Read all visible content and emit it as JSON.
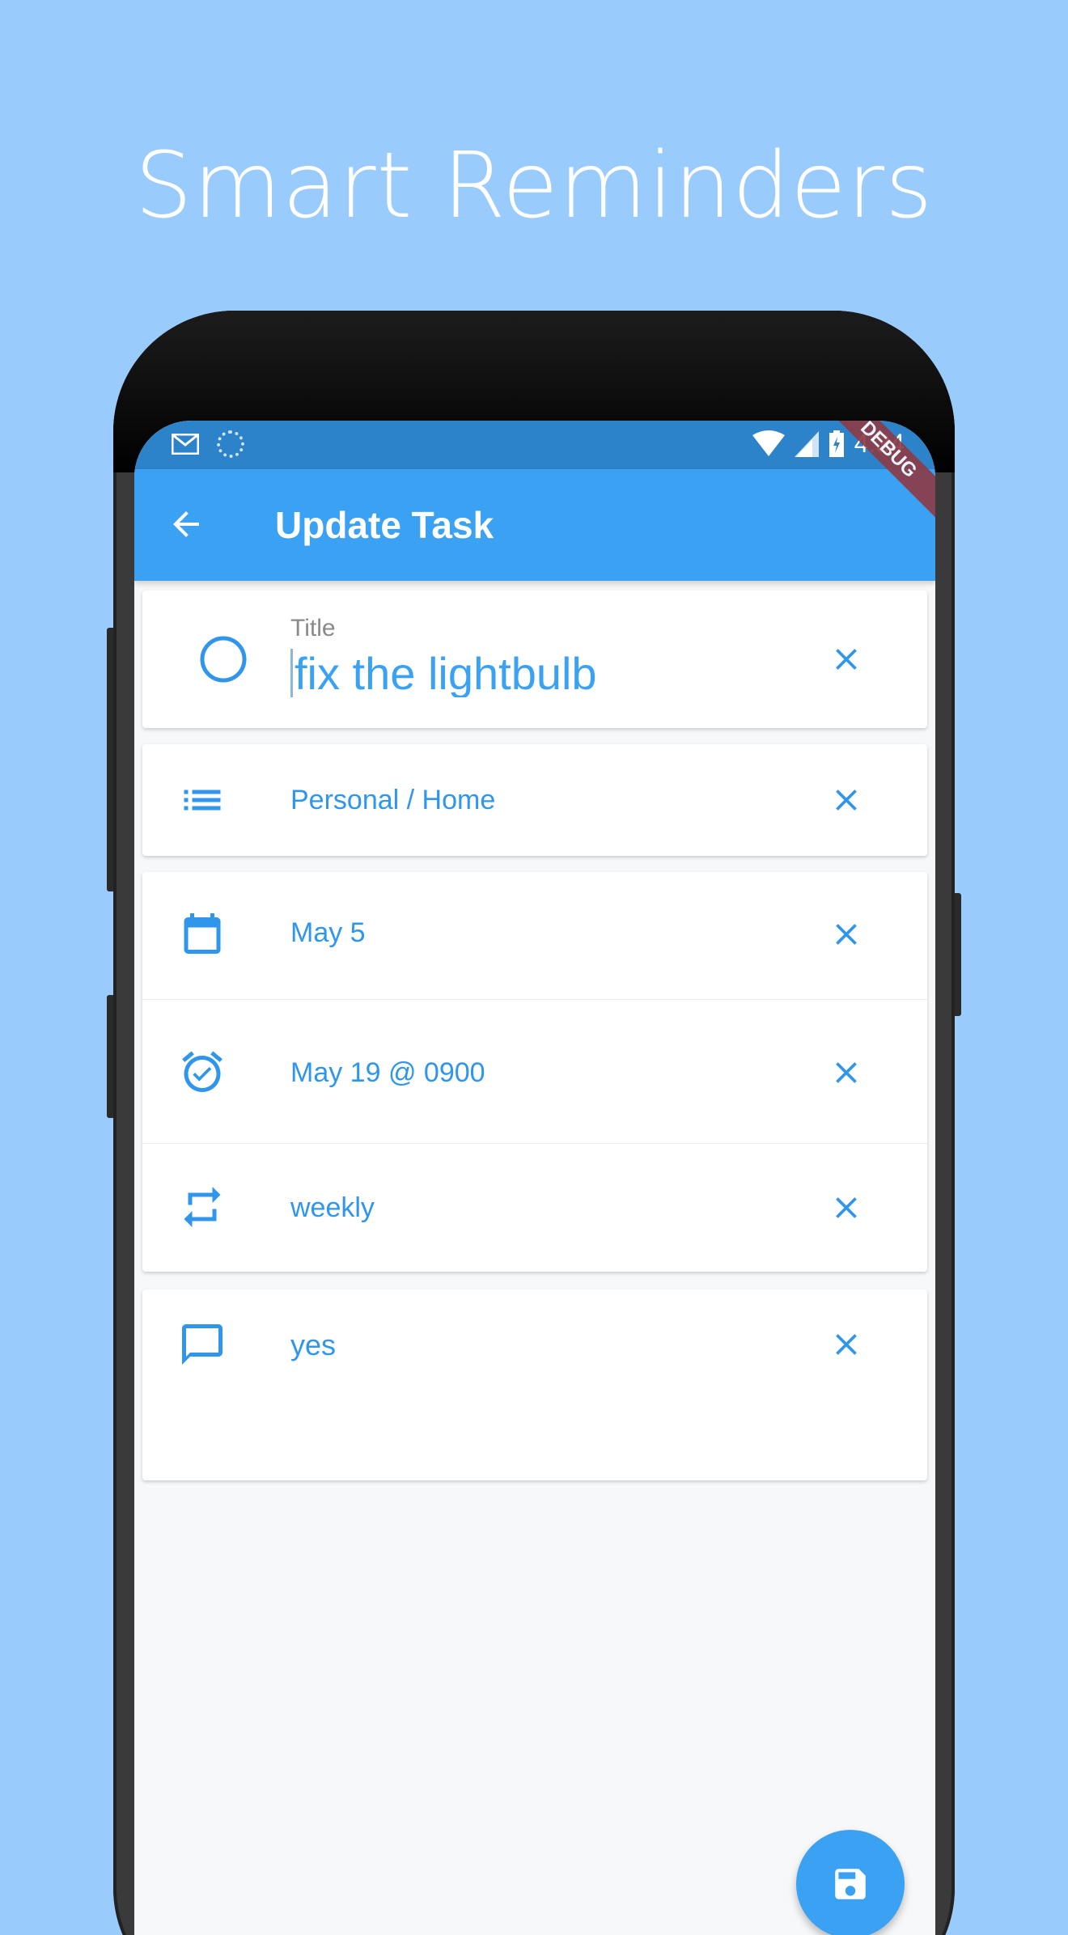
{
  "promo": {
    "headline": "Smart Reminders"
  },
  "status_bar": {
    "time": "4:34"
  },
  "app_bar": {
    "title": "Update Task",
    "debug_label": "DEBUG"
  },
  "form": {
    "title_caption": "Title",
    "title_value": "fix the lightbulb",
    "list": "Personal / Home",
    "due_date": "May 5",
    "reminder": "May 19 @ 0900",
    "repeat": "weekly",
    "note": "yes"
  },
  "colors": {
    "background": "#9acbfd",
    "app_bar": "#3aa1f3",
    "status_bar": "#2d83c9",
    "accent": "#2f96ec"
  },
  "icons": {
    "back": "arrow-left-icon",
    "title": "circle-outline-icon",
    "list": "list-icon",
    "date": "calendar-icon",
    "reminder": "alarm-check-icon",
    "repeat": "repeat-icon",
    "note": "comment-icon",
    "clear": "close-icon",
    "save": "floppy-disk-icon"
  }
}
